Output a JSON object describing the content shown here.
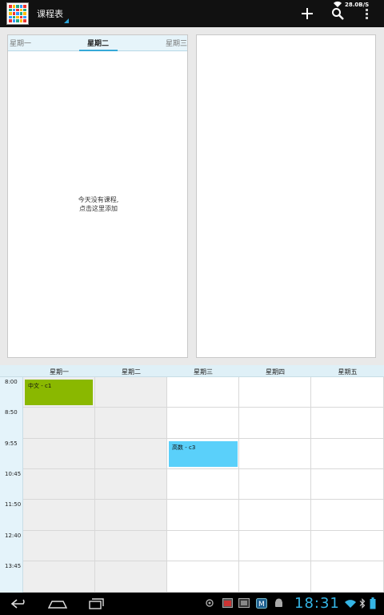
{
  "app": {
    "title": "课程表"
  },
  "status": {
    "speed": "28.0B/S"
  },
  "day_panel": {
    "tabs": {
      "prev": "星期一",
      "current": "星期二",
      "next": "星期三"
    },
    "empty_line1": "今天没有课程,",
    "empty_line2": "点击这里添加"
  },
  "week": {
    "days": [
      "星期一",
      "星期二",
      "星期三",
      "星期四",
      "星期五"
    ],
    "times": [
      "8:00",
      "8:50",
      "9:55",
      "10:45",
      "11:50",
      "12:40",
      "13:45"
    ],
    "courses": [
      {
        "label": "中文 - c1",
        "color": "#8ab800"
      },
      {
        "label": "高数 - c3",
        "color": "#5ad0fa"
      }
    ]
  },
  "system": {
    "clock": "18:31"
  },
  "colors": {
    "accent": "#36a9d8",
    "actionbar": "#111111"
  }
}
